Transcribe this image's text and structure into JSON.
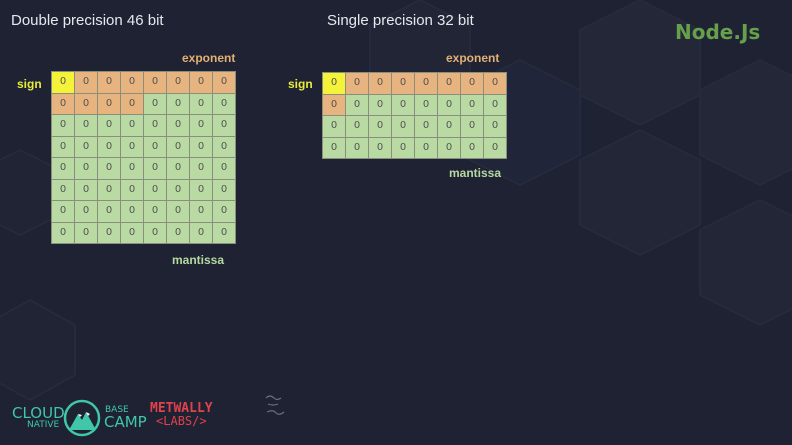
{
  "double": {
    "title": "Double precision 46 bit",
    "sign_label": "sign",
    "exponent_label": "exponent",
    "mantissa_label": "mantissa",
    "rows": 8,
    "cols": 8,
    "sign_bits": 1,
    "exponent_bits": 11,
    "value": "0"
  },
  "single": {
    "title": "Single precision 32 bit",
    "sign_label": "sign",
    "exponent_label": "exponent",
    "mantissa_label": "mantissa",
    "rows": 4,
    "cols": 8,
    "sign_bits": 1,
    "exponent_bits": 8,
    "value": "0"
  },
  "brand": {
    "node": "Node.Js",
    "cloud": "CLOUD",
    "native": "NATIVE",
    "base": "BASE",
    "camp": "CAMP",
    "metwally_top": "METWALLY",
    "metwally_bottom": "<LABS/>"
  },
  "colors": {
    "sign": "#f4f33a",
    "exponent": "#e7b37e",
    "mantissa": "#b9dba3",
    "background": "#1e2233"
  }
}
